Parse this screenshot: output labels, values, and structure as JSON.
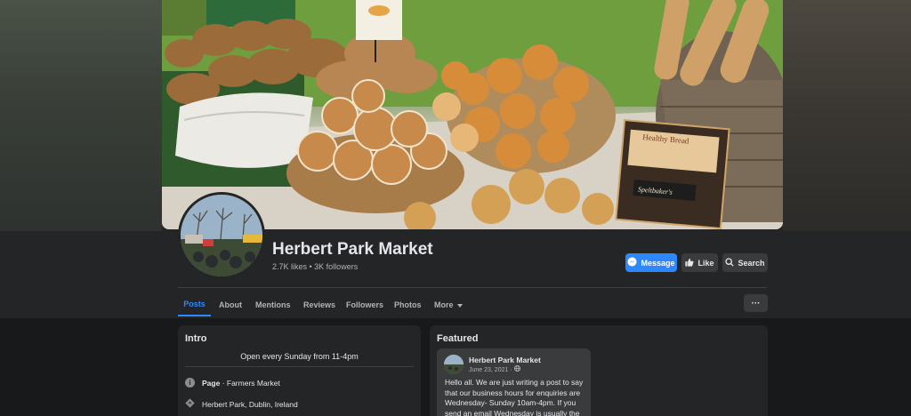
{
  "page": {
    "name": "Herbert Park Market",
    "stats": "2.7K likes • 3K followers"
  },
  "actions": {
    "message_label": "Message",
    "like_label": "Like",
    "search_label": "Search"
  },
  "tabs": [
    {
      "label": "Posts",
      "active": true
    },
    {
      "label": "About",
      "active": false
    },
    {
      "label": "Mentions",
      "active": false
    },
    {
      "label": "Reviews",
      "active": false
    },
    {
      "label": "Followers",
      "active": false
    },
    {
      "label": "Photos",
      "active": false
    },
    {
      "label": "More",
      "active": false
    }
  ],
  "more_menu_label": "···",
  "intro": {
    "title": "Intro",
    "bio": "Open every Sunday from 11-4pm",
    "category_prefix": "Page",
    "category": " · Farmers Market",
    "location": "Herbert Park, Dublin, Ireland"
  },
  "featured": {
    "title": "Featured",
    "post": {
      "author": "Herbert Park Market",
      "date": "June 23, 2021 · ",
      "body": "Hello all. We are just writing a post to say that our business hours for enquiries are Wednesday- Sunday 10am-4pm. If you send an email Wednesday is usually the"
    }
  },
  "cover": {
    "sign_text": "Healthy Bread",
    "sign_subtext": "Speltbaker's"
  },
  "colors": {
    "accent": "#2d88ff",
    "background": "#18191a",
    "surface": "#242526",
    "button": "#3a3b3c"
  },
  "icons": [
    "messenger-icon",
    "thumbs-up-icon",
    "search-icon",
    "chevron-down-icon",
    "info-icon",
    "location-pin-icon",
    "globe-icon"
  ]
}
